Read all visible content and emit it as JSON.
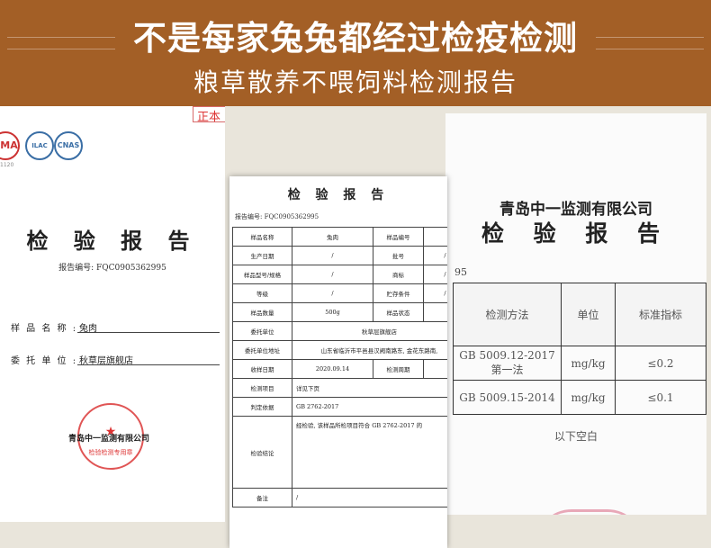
{
  "header": {
    "title": "不是每家兔兔都经过检疫检测",
    "subtitle": "粮草散养不喂饲料检测报告"
  },
  "left_report": {
    "corner_stamp": "正本",
    "cert_marks": [
      "CMA",
      "CNAS"
    ],
    "cert_code": "1120",
    "title": "检 验 报 告",
    "report_no": "报告编号: FQC0905362995",
    "fields": [
      {
        "label": "样 品 名 称 :",
        "value": "兔肉"
      },
      {
        "label": "委 托 单 位 :",
        "value": "秋草层旗舰店"
      }
    ],
    "seal_company": "青岛中一监测有限公司",
    "seal_bottom": "检验检测专用章"
  },
  "middle_report": {
    "top_cut": "青岛中一监测有限公司",
    "title": "检 验 报 告",
    "report_no": "报告编号: FQC0905362995",
    "rows": [
      [
        "样品名称",
        "兔肉",
        "样品编号",
        ""
      ],
      [
        "生产日期",
        "/",
        "批号",
        "/"
      ],
      [
        "样品型号/规格",
        "/",
        "商标",
        "/"
      ],
      [
        "等级",
        "/",
        "贮存条件",
        "/"
      ],
      [
        "样品数量",
        "500g",
        "样品状态",
        ""
      ]
    ],
    "client_label": "委托单位",
    "client_value": "秋草层旗舰店",
    "address_label": "委托单位地址",
    "address_value": "山东省临沂市平邑县汉阙南路东, 金花东路南,",
    "date_label": "收样日期",
    "date_value": "2020.09.14",
    "period_label": "检测周期",
    "items_label": "检测项目",
    "items_value": "详见下页",
    "basis_label": "判定依据",
    "basis_value": "GB 2762-2017",
    "conclusion_label": "检验结论",
    "conclusion_value": "经检验, 该样品所检项目符合 GB 2762-2017 的",
    "remark_label": "备注",
    "remark_value": "/"
  },
  "right_report": {
    "company": "青岛中一监测有限公司",
    "title": "检 验 报 告",
    "no_fragment": "95",
    "headers": [
      "检测方法",
      "单位",
      "标准指标"
    ],
    "rows": [
      {
        "method": "GB 5009.12-2017 第一法",
        "unit": "mg/kg",
        "limit": "≤0.2"
      },
      {
        "method": "GB 5009.15-2014",
        "unit": "mg/kg",
        "limit": "≤0.1"
      }
    ],
    "blank_note": "以下空白"
  }
}
